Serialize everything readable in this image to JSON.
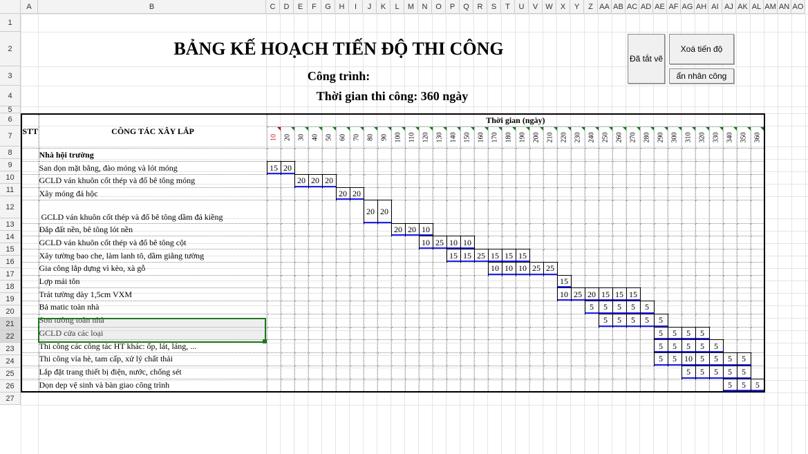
{
  "columns": {
    "labels": [
      "A",
      "B",
      "C",
      "D",
      "E",
      "F",
      "G",
      "H",
      "I",
      "J",
      "K",
      "L",
      "M",
      "N",
      "O",
      "P",
      "Q",
      "R",
      "S",
      "T",
      "U",
      "V",
      "W",
      "X",
      "Y",
      "Z",
      "AA",
      "AB",
      "AC",
      "AD",
      "AE",
      "AF",
      "AG",
      "AH",
      "AI",
      "AJ",
      "AK",
      "AL",
      "AM",
      "AN",
      "AO"
    ],
    "widths": [
      25,
      330,
      20,
      20,
      20,
      20,
      20,
      20,
      20,
      20,
      20,
      20,
      20,
      20,
      20,
      20,
      20,
      20,
      20,
      20,
      20,
      20,
      20,
      20,
      20,
      20,
      20,
      20,
      20,
      20,
      20,
      20,
      20,
      20,
      20,
      20,
      20,
      20,
      20,
      20,
      20
    ]
  },
  "rows": {
    "heights": [
      26,
      50,
      28,
      30,
      10,
      18,
      30,
      18,
      18,
      18,
      18,
      32,
      18,
      18,
      18,
      18,
      18,
      18,
      18,
      18,
      18,
      18,
      18,
      18,
      18,
      18,
      18
    ]
  },
  "buttons": {
    "status": "Đã tắt vẽ",
    "clear": "Xoá tiến độ",
    "hide": "ẩn nhân công"
  },
  "titles": {
    "main": "BẢNG KẾ HOẠCH TIẾN ĐỘ THI CÔNG",
    "project": "Công trình:",
    "duration": "Thời gian thi công: 360 ngày"
  },
  "headers": {
    "stt": "STT",
    "task": "CÔNG TÁC XÂY LẮP",
    "time": "Thời gian (ngày)"
  },
  "days": [
    10,
    20,
    30,
    40,
    50,
    60,
    70,
    80,
    90,
    100,
    110,
    120,
    130,
    140,
    150,
    160,
    170,
    180,
    190,
    200,
    210,
    220,
    230,
    240,
    250,
    260,
    270,
    280,
    290,
    300,
    310,
    320,
    330,
    340,
    350,
    360
  ],
  "tasks": [
    {
      "row": 8,
      "name": "Nhà hội trường",
      "bold": true
    },
    {
      "row": 9,
      "name": "San dọn mặt bằng, đào móng và lót móng",
      "start": 0,
      "values": [
        15,
        20
      ]
    },
    {
      "row": 10,
      "name": "GCLD ván khuôn cốt thép và đổ bê tông móng",
      "start": 2,
      "values": [
        20,
        20,
        20
      ]
    },
    {
      "row": 11,
      "name": "Xây móng đá hộc",
      "start": 5,
      "values": [
        20,
        20
      ]
    },
    {
      "row": 12,
      "name": "GCLD ván khuôn cốt thép và đổ bê tông dầm đá kiềng",
      "start": 7,
      "values": [
        20,
        20
      ]
    },
    {
      "row": 13,
      "name": "Đắp đất nền, bê tông lót nền",
      "start": 9,
      "values": [
        20,
        20,
        10
      ]
    },
    {
      "row": 14,
      "name": "GCLD ván khuôn cốt thép và đổ bê tông cột",
      "start": 11,
      "values": [
        10,
        25,
        10,
        10
      ]
    },
    {
      "row": 15,
      "name": "Xây tường bao che, làm lanh tô, dầm giằng tường",
      "start": 13,
      "values": [
        15,
        15,
        25,
        15,
        15,
        15
      ]
    },
    {
      "row": 16,
      "name": "Gia công lắp dựng vì kèo, xà gỗ",
      "start": 16,
      "values": [
        10,
        10,
        10,
        25,
        25
      ]
    },
    {
      "row": 17,
      "name": "Lợp mái tôn",
      "start": 21,
      "values": [
        15
      ]
    },
    {
      "row": 18,
      "name": "Trát tường dày 1,5cm VXM",
      "start": 21,
      "values": [
        10,
        25,
        20,
        15,
        15,
        15
      ]
    },
    {
      "row": 19,
      "name": "Bả matic toàn nhà",
      "start": 23,
      "values": [
        5,
        5,
        5,
        5,
        5
      ]
    },
    {
      "row": 20,
      "name": "Sơn tường toàn nhà",
      "start": 24,
      "values": [
        5,
        5,
        5,
        5,
        5
      ]
    },
    {
      "row": 21,
      "name": "GCLD cửa các loại",
      "start": 28,
      "values": [
        5,
        5,
        5,
        5
      ]
    },
    {
      "row": 22,
      "name": "Thi công các công tác HT khác: ốp, lát, láng, ...",
      "start": 28,
      "values": [
        5,
        5,
        5,
        5,
        5
      ]
    },
    {
      "row": 23,
      "name": "Thi công vỉa hè, tam cấp, xử lý chất thải",
      "start": 28,
      "values": [
        5,
        5,
        10,
        5,
        5,
        5,
        5
      ]
    },
    {
      "row": 24,
      "name": "Lắp đặt trang thiết bị điện, nước, chống sét",
      "start": 30,
      "values": [
        5,
        5,
        5,
        5,
        5
      ]
    },
    {
      "row": 25,
      "name": "Dọn dẹp vệ sinh và bàn giao công trình",
      "start": 33,
      "values": [
        5,
        5,
        5
      ]
    }
  ],
  "selection": {
    "rows": [
      21,
      22
    ]
  }
}
